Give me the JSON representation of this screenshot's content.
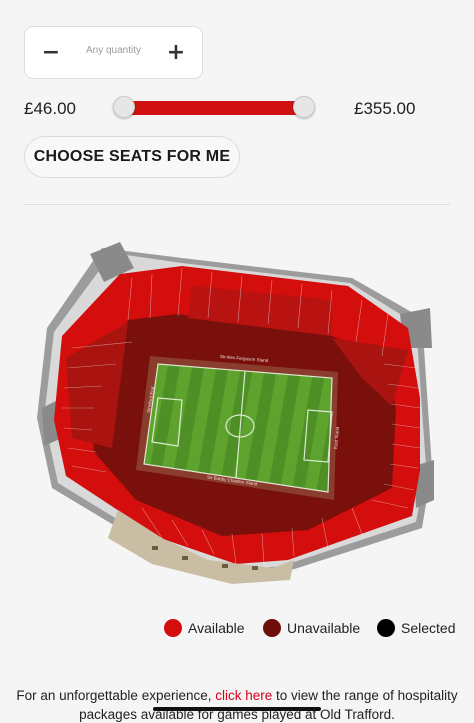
{
  "quantity": {
    "minus": "−",
    "plus": "+",
    "placeholder": "Any quantity"
  },
  "price": {
    "min": "£46.00",
    "max": "£355.00",
    "range_fill": 1.0
  },
  "choose_button": "CHOOSE SEATS FOR ME",
  "stadium": {
    "stand_north": "Sir Alex Ferguson Stand",
    "stand_south": "Sir Bobby Charlton Stand",
    "stand_east": "East Stand",
    "stand_west": "Stretford End"
  },
  "legend": [
    {
      "label": "Available",
      "color": "#d40d0d"
    },
    {
      "label": "Unavailable",
      "color": "#6d0e0b"
    },
    {
      "label": "Selected",
      "color": "#000000"
    }
  ],
  "footer": {
    "before": "For an unforgettable experience, ",
    "link": "click here",
    "after": " to view the range of hospitality packages available for games played at Old Trafford."
  }
}
